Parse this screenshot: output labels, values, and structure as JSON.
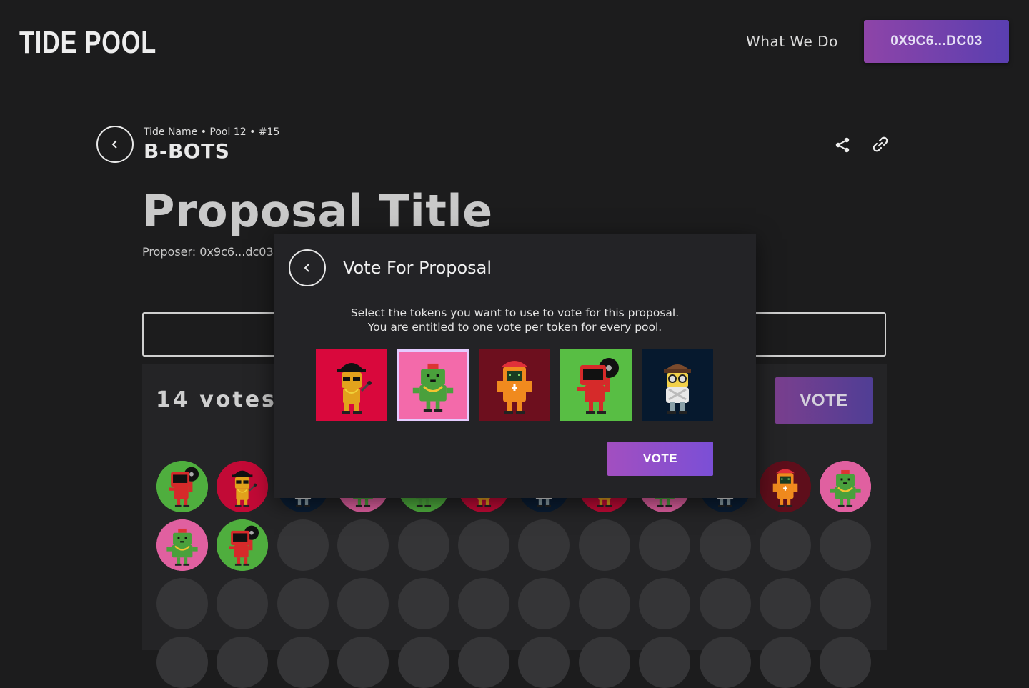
{
  "header": {
    "logo": "TIDE POOL",
    "nav_link": "What We Do",
    "wallet_label": "0X9C6...DC03"
  },
  "pool": {
    "breadcrumb": "Tide Name • Pool 12 • #15",
    "name": "B-BOTS"
  },
  "proposal": {
    "title": "Proposal Title",
    "proposer": "Proposer: 0x9c6...dc03"
  },
  "voting": {
    "count_label": "14 votes",
    "vote_label": "VOTE"
  },
  "modal": {
    "title": "Vote For Proposal",
    "description_line1": "Select the tokens you want to use to vote for this proposal.",
    "description_line2": "You are entitled to one vote per token for every pool.",
    "vote_label": "VOTE",
    "tokens": [
      {
        "bot": "yellow-rapper-bot",
        "background": "#d9083c",
        "selected": false
      },
      {
        "bot": "green-chain-bot",
        "background": "#f36aaa",
        "selected": true
      },
      {
        "bot": "orange-gameboy-bot",
        "background": "#6d0f1e",
        "selected": false
      },
      {
        "bot": "red-vinyl-bot",
        "background": "#58be44",
        "selected": false
      },
      {
        "bot": "white-beanie-bot",
        "background": "#06192e",
        "selected": false
      }
    ]
  },
  "colors": {
    "page_bg": "#1c1c1d",
    "accent_purple": "#7b4fd6",
    "accent_magenta": "#a24fc0"
  },
  "voter_avatars": [
    "red-vinyl-bot",
    "yellow-rapper-bot",
    "white-beanie-bot",
    "green-chain-bot",
    "green-vinyl-bot",
    "yellow-rapper-bot",
    "white-beanie-bot",
    "yellow-rapper-bot",
    "green-chain-bot",
    "white-beanie-bot",
    "orange-gameboy-bot",
    "green-chain-bot",
    "green-chain-bot",
    "red-vinyl-bot"
  ]
}
